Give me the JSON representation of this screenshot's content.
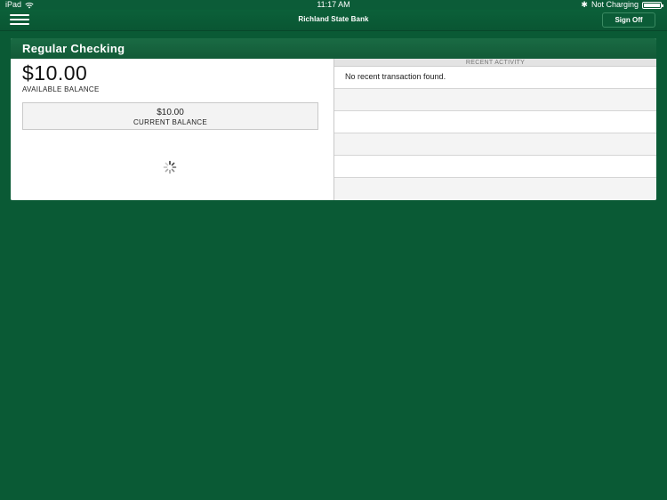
{
  "status_bar": {
    "device": "iPad",
    "time": "11:17 AM",
    "bluetooth_glyph": "✱",
    "charging": "Not Charging",
    "battery_level": 1.0
  },
  "nav": {
    "title": "Richland State Bank",
    "sign_off": "Sign Off"
  },
  "account": {
    "name": "Regular Checking",
    "available_amount": "$10.00",
    "available_label": "AVAILABLE BALANCE",
    "current_amount": "$10.00",
    "current_label": "CURRENT BALANCE"
  },
  "recent_activity": {
    "header": "RECENT ACTIVITY",
    "rows": [
      "No recent transaction found.",
      "",
      "",
      "",
      "",
      ""
    ]
  },
  "colors": {
    "background": "#0a5a35",
    "header": "#125a37"
  }
}
